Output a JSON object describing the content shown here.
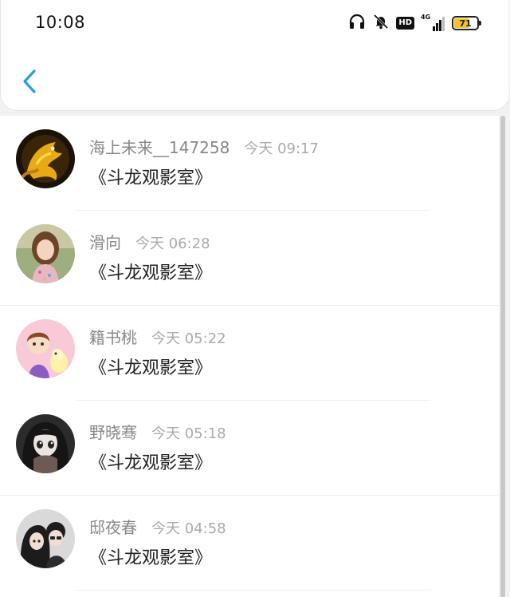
{
  "status_bar": {
    "time": "10:08",
    "hd_label": "HD",
    "network_label": "4G",
    "battery_level": "71",
    "battery_fraction": 0.71,
    "icons": [
      "headphones-icon",
      "mute-bell-icon",
      "hd-icon",
      "cellular-signal-icon",
      "battery-icon"
    ]
  },
  "nav": {
    "back_icon": "chevron-left-icon",
    "accent_color": "#2f9be4"
  },
  "comments": [
    {
      "name": "海上未来__147258",
      "time": "今天 09:17",
      "text": "《斗龙观影室》",
      "avatar": "golden-dragon-avatar"
    },
    {
      "name": "滑向",
      "time": "今天 06:28",
      "text": "《斗龙观影室》",
      "avatar": "girl-portrait-avatar"
    },
    {
      "name": "籍书桃",
      "time": "今天 05:22",
      "text": "《斗龙观影室》",
      "avatar": "cartoon-kids-avatar"
    },
    {
      "name": "野晓骞",
      "time": "今天 05:18",
      "text": "《斗龙观影室》",
      "avatar": "anime-girl-avatar"
    },
    {
      "name": "邸夜春",
      "time": "今天 04:58",
      "text": "《斗龙观影室》",
      "avatar": "couple-avatar"
    }
  ]
}
